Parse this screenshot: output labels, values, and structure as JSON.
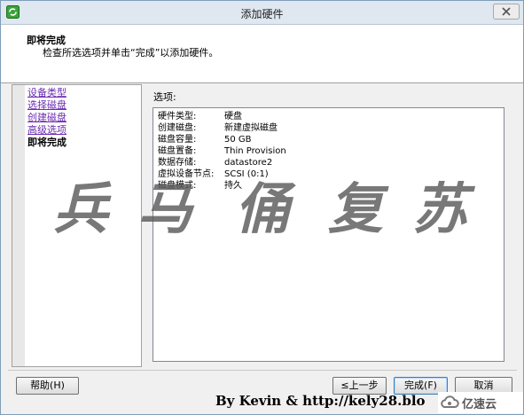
{
  "window": {
    "title": "添加硬件"
  },
  "header": {
    "title": "即将完成",
    "subtitle": "检查所选选项并单击“完成”以添加硬件。"
  },
  "nav": {
    "items": [
      {
        "label": "设备类型",
        "state": "link"
      },
      {
        "label": "选择磁盘",
        "state": "link"
      },
      {
        "label": "创建磁盘",
        "state": "link"
      },
      {
        "label": "高级选项",
        "state": "link"
      },
      {
        "label": "即将完成",
        "state": "current"
      }
    ]
  },
  "options": {
    "label": "选项:",
    "rows": [
      {
        "key": "硬件类型:",
        "value": "硬盘"
      },
      {
        "key": "创建磁盘:",
        "value": "新建虚拟磁盘"
      },
      {
        "key": "磁盘容量:",
        "value": "50 GB"
      },
      {
        "key": "磁盘置备:",
        "value": "Thin Provision"
      },
      {
        "key": "数据存储:",
        "value": "datastore2"
      },
      {
        "key": "虚拟设备节点:",
        "value": "SCSI (0:1)"
      },
      {
        "key": "磁盘模式:",
        "value": "持久"
      }
    ]
  },
  "buttons": {
    "help": "帮助(H)",
    "back": "≤上一步",
    "finish": "完成(F)",
    "cancel": "取消"
  },
  "watermark": {
    "chars": [
      "兵",
      "马",
      "俑",
      "复",
      "苏"
    ]
  },
  "credit": {
    "text": "By Kevin & http://kely28.blo"
  },
  "brand": {
    "text": "亿速云"
  },
  "colors": {
    "link": "#6a2bb0",
    "titlebar": "#dfe7f0",
    "logo_green": "#3aa33a"
  }
}
